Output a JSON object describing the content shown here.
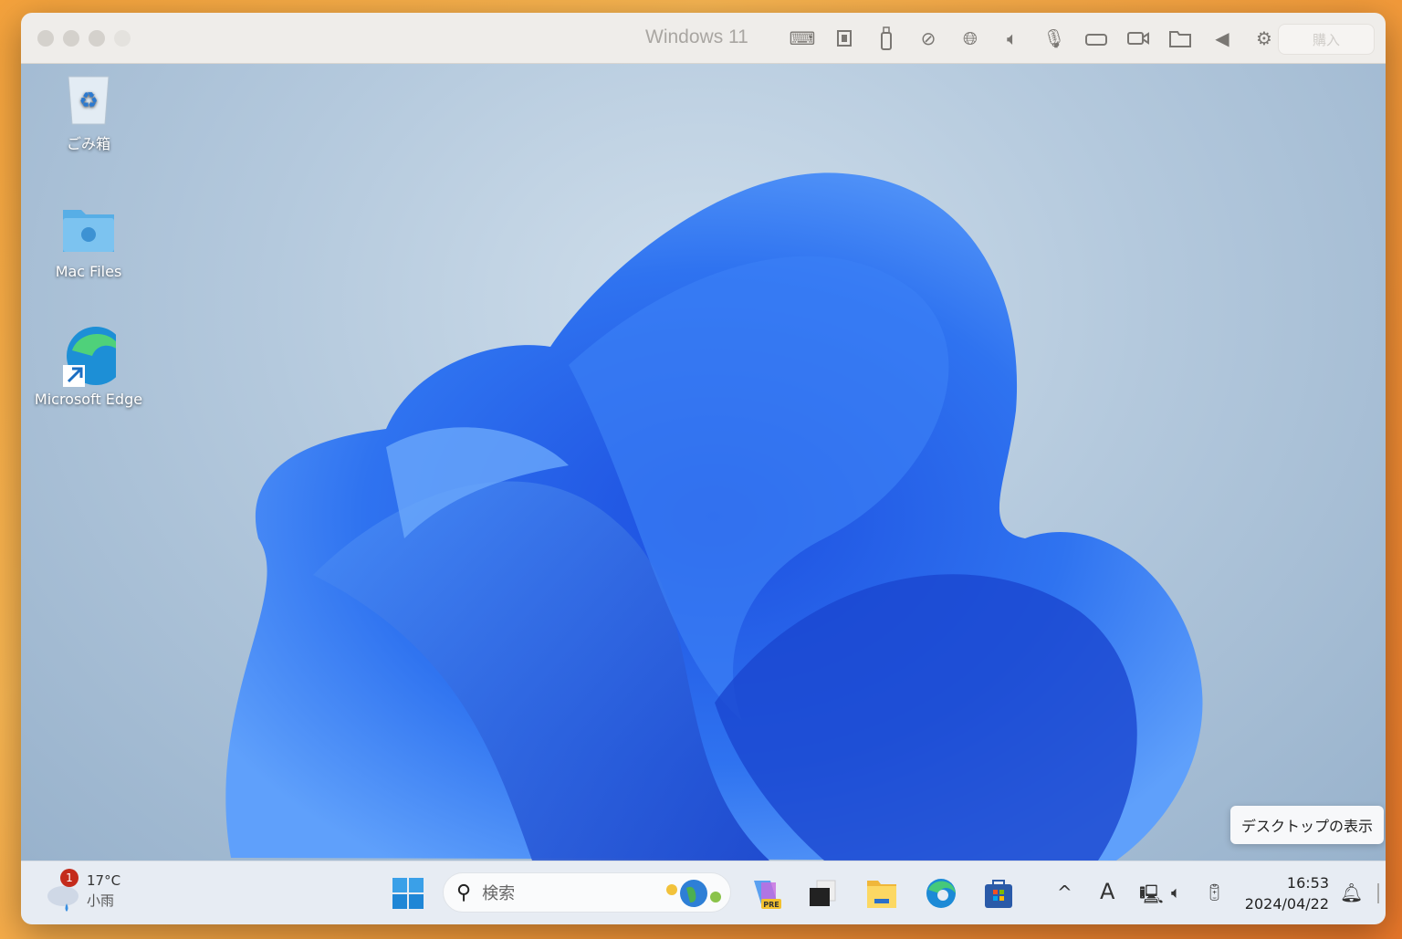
{
  "window": {
    "title": "Windows 11",
    "buy_label": "購入",
    "toolbar_icons": [
      "keyboard-icon",
      "cpu-icon",
      "usb-icon",
      "network-off-icon",
      "globe-icon",
      "speaker-icon",
      "microphone-icon",
      "disk-icon",
      "camera-icon",
      "shared-folder-icon",
      "back-arrow-icon",
      "gear-icon"
    ]
  },
  "desktop": {
    "icons": [
      {
        "label": "ごみ箱"
      },
      {
        "label": "Mac Files"
      },
      {
        "label": "Microsoft Edge"
      }
    ],
    "tooltip": "デスクトップの表示"
  },
  "taskbar": {
    "weather": {
      "badge": "1",
      "temp": "17°C",
      "condition": "小雨"
    },
    "search_placeholder": "検索",
    "copilot_badge": "PRE",
    "clock": {
      "time": "16:53",
      "date": "2024/04/22"
    },
    "ime": "A"
  }
}
